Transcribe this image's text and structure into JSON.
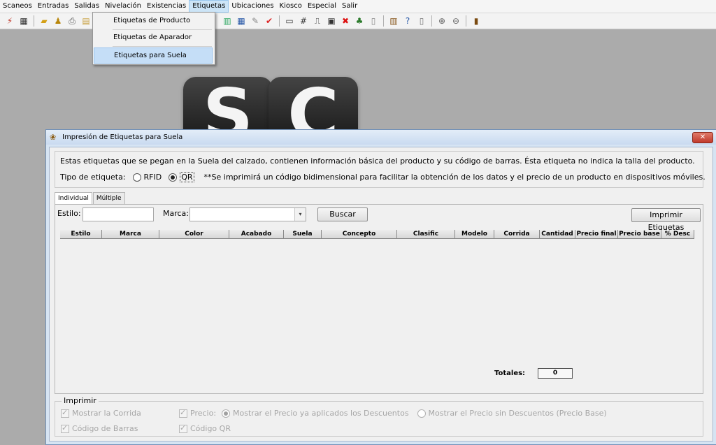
{
  "menubar": {
    "items": [
      "Scaneos",
      "Entradas",
      "Salidas",
      "Nivelación",
      "Existencias",
      "Etiquetas",
      "Ubicaciones",
      "Kiosco",
      "Especial",
      "Salir"
    ],
    "active": "Etiquetas"
  },
  "toolbar": {
    "icons": [
      "lightning-icon",
      "film-icon",
      "folder-open-icon",
      "users-icon",
      "printer-icon",
      "report-icon",
      "search-list-icon",
      "grid-icon",
      "pen-icon",
      "checkmark-icon",
      "window-icon",
      "hashtag-icon",
      "tag-icon",
      "cash-register-icon",
      "delete-icon",
      "people-icon",
      "document-icon",
      "book-icon",
      "help-icon",
      "clipboard-icon",
      "zoom-in-icon",
      "zoom-out-icon",
      "exit-icon"
    ]
  },
  "dropdown": {
    "items": [
      "Etiquetas de Producto",
      "Etiquetas de Aparador",
      "Etiquetas para Suela"
    ],
    "selected": "Etiquetas para Suela"
  },
  "background_logo": {
    "letters": [
      "S",
      "C"
    ]
  },
  "dialog": {
    "title": "Impresión de Etiquetas para Suela",
    "close_label": "✕",
    "info_text": "Estas etiquetas que se pegan en la Suela del calzado, contienen información básica del producto y su código de barras. Ésta etiqueta no indica la talla del producto.",
    "tipo_label": "Tipo de etiqueta:",
    "tipo_options": [
      "RFID",
      "QR"
    ],
    "tipo_selected": "QR",
    "qr_note": "**Se imprimirá un código bidimensional para facilitar la obtención de los datos y el precio de un producto en dispositivos móviles.",
    "tabs": [
      "Individual",
      "Múltiple"
    ],
    "active_tab": "Individual",
    "estilo_label": "Estilo:",
    "estilo_value": "",
    "marca_label": "Marca:",
    "marca_value": "",
    "buscar_label": "Buscar",
    "imprimir_etiquetas_label": "Imprimir Etiquetas",
    "columns": [
      "Estilo",
      "Marca",
      "Color",
      "Acabado",
      "Suela",
      "Concepto",
      "Clasific",
      "Modelo",
      "Corrida",
      "Cantidad",
      "Precio final",
      "Precio base",
      "% Desc"
    ],
    "rows": [],
    "totales_label": "Totales:",
    "totales_value": "0",
    "imprimir_legend": "Imprimir",
    "mostrar_corrida": "Mostrar la Corrida",
    "codigo_barras": "Código de Barras",
    "precio_label": "Precio:",
    "precio_opt1": "Mostrar el Precio ya aplicados los Descuentos",
    "precio_opt2": "Mostrar el Precio sin Descuentos (Precio Base)",
    "codigo_qr": "Código QR"
  }
}
